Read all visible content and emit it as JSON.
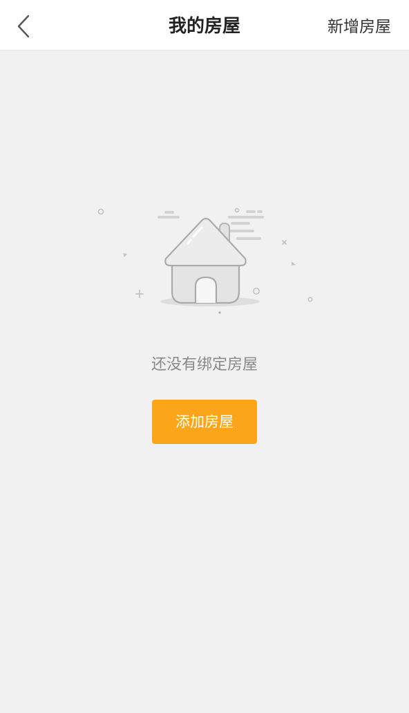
{
  "header": {
    "title": "我的房屋",
    "right_action_label": "新增房屋",
    "back_icon": "chevron-left-icon"
  },
  "empty_state": {
    "illustration_icon": "house-icon",
    "message": "还没有绑定房屋",
    "button_label": "添加房屋"
  },
  "colors": {
    "background": "#f1f1f1",
    "header_background": "#ffffff",
    "accent": "#fba61a",
    "title_text": "#222222",
    "muted_text": "#888888"
  }
}
